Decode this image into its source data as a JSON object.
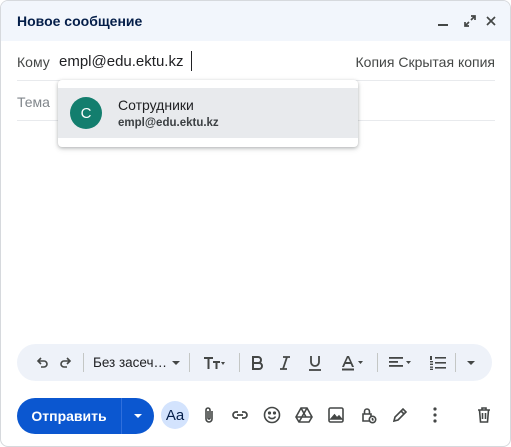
{
  "window": {
    "title": "Новое сообщение"
  },
  "to": {
    "label": "Кому",
    "value": "empl@edu.ektu.kz",
    "cc": "Копия",
    "bcc": "Скрытая копия"
  },
  "subject": {
    "placeholder": "Тема"
  },
  "suggestion": {
    "initial": "С",
    "name": "Сотрудники",
    "email": "empl@edu.ektu.kz",
    "avatar_color": "#137e6e"
  },
  "toolbar": {
    "font": "Без засеч…"
  },
  "bottom": {
    "send_label": "Отправить",
    "formatting_label": "Aa",
    "send_color": "#0b57d0"
  }
}
